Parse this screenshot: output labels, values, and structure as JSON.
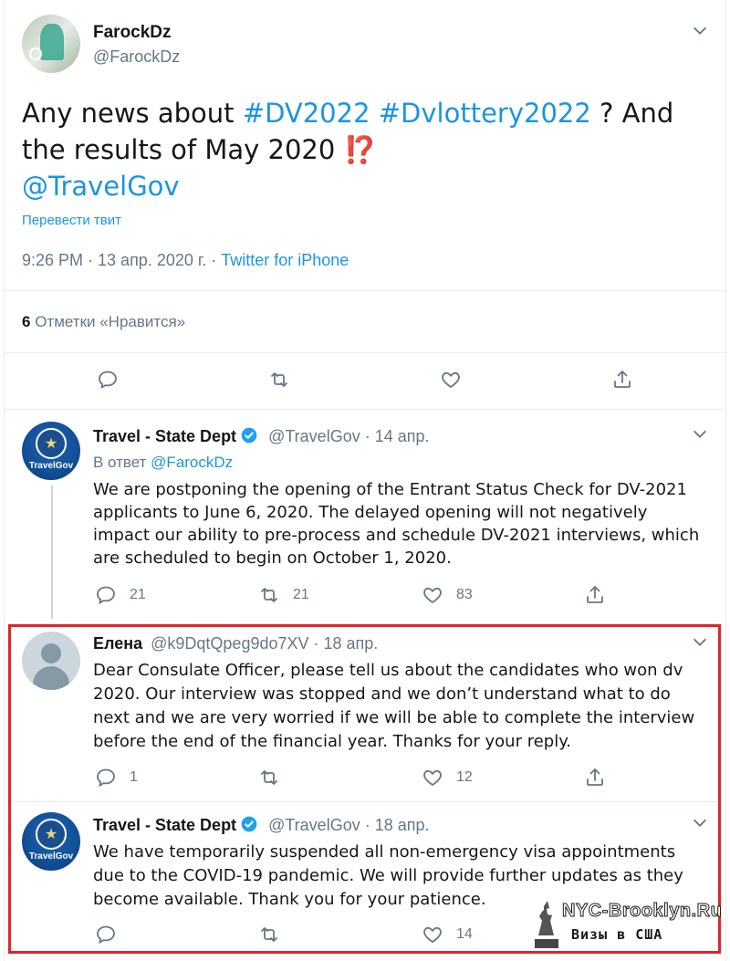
{
  "main_tweet": {
    "name": "FarockDz",
    "handle": "@FarockDz",
    "text_prefix": "Any news about ",
    "hashtag1": "#DV2022",
    "hashtag2": "#Dvlottery2022",
    "text_mid": " ? And the results of May 2020 ",
    "emoji": "⁉️",
    "mention": "@TravelGov",
    "translate": "Перевести твит",
    "time": "9:26 PM · 13 апр. 2020 г. · ",
    "source": "Twitter for iPhone",
    "likes_count": "6",
    "likes_label": " Отметки «Нравится»"
  },
  "reply1": {
    "name": "Travel - State Dept",
    "handle": "@TravelGov",
    "date": " · 14 апр.",
    "reply_prefix": "В ответ ",
    "reply_to": "@FarockDz",
    "text": "We are postponing the opening of the Entrant Status Check for DV-2021 applicants to June 6, 2020. The delayed opening will not negatively impact our ability to pre-process and schedule DV-2021 interviews, which are scheduled to begin on October 1, 2020.",
    "replies": "21",
    "retweets": "21",
    "likes": "83",
    "avatar_text": "TravelGov"
  },
  "reply2": {
    "name": "Елена",
    "handle": "@k9DqtQpeg9do7XV",
    "date": " · 18 апр.",
    "text": "Dear Consulate Officer, please tell us about the candidates who won dv 2020. Our interview was stopped and we don’t understand what to do next and we are very worried if we will be able to complete the interview before the end of the financial year.  Thanks for your reply.",
    "replies": "1",
    "retweets": "",
    "likes": "12"
  },
  "reply3": {
    "name": "Travel - State Dept",
    "handle": "@TravelGov",
    "date": " · 18 апр.",
    "text": "We have temporarily suspended all non-emergency visa appointments due to the COVID-19 pandemic. We will provide further updates as they become available. Thank you for your patience.",
    "replies": "",
    "retweets": "",
    "likes": "14",
    "avatar_text": "TravelGov"
  },
  "watermark": {
    "site": "NYC-Brooklyn.Ru",
    "tagline": "Визы в США"
  },
  "colors": {
    "accent": "#1b95e0",
    "muted": "#657786",
    "highlight_border": "#e0242a",
    "emoji_red": "#be1931"
  }
}
